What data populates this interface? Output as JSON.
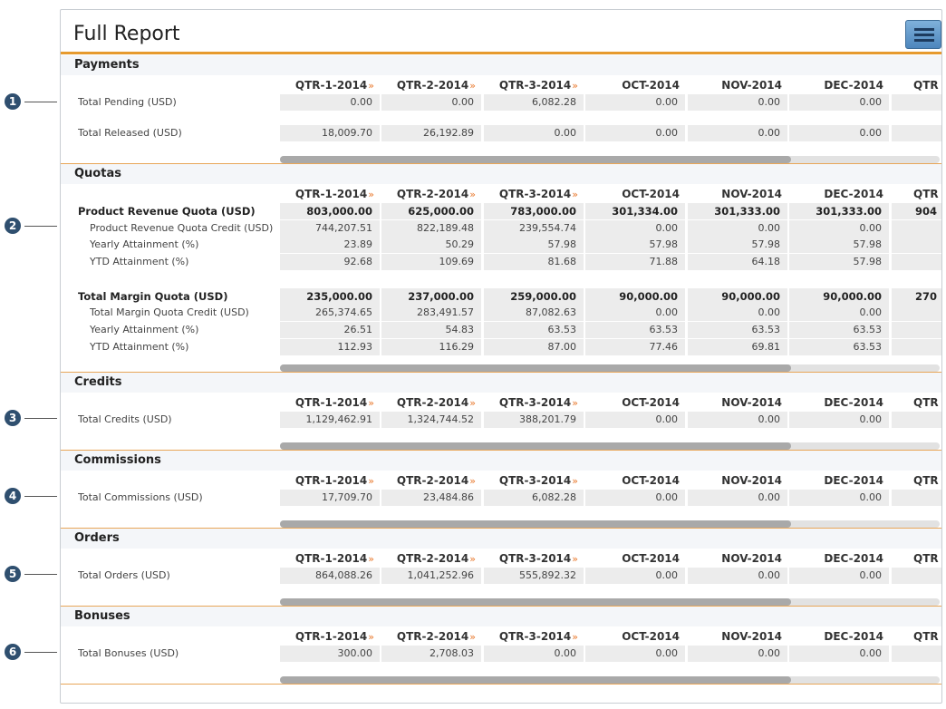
{
  "report": {
    "title": "Full Report"
  },
  "menu_icon": "hamburger-menu-icon",
  "columns": [
    "QTR-1-2014",
    "QTR-2-2014",
    "QTR-3-2014",
    "OCT-2014",
    "NOV-2014",
    "DEC-2014",
    "QTR"
  ],
  "column_expandable": [
    true,
    true,
    true,
    false,
    false,
    false,
    false
  ],
  "callouts": [
    "1",
    "2",
    "3",
    "4",
    "5",
    "6"
  ],
  "colors": {
    "accent": "#e69a2e",
    "callout": "#2f4f6f",
    "arrow": "#e8772a"
  },
  "sections": {
    "payments": {
      "title": "Payments",
      "rows": [
        {
          "label": "Total Pending (USD)",
          "values": [
            "0.00",
            "0.00",
            "6,082.28",
            "0.00",
            "0.00",
            "0.00",
            ""
          ]
        },
        {
          "label": "Total Released (USD)",
          "values": [
            "18,009.70",
            "26,192.89",
            "0.00",
            "0.00",
            "0.00",
            "0.00",
            ""
          ]
        }
      ]
    },
    "quotas": {
      "title": "Quotas",
      "rows": [
        {
          "label": "Product Revenue Quota (USD)",
          "values": [
            "803,000.00",
            "625,000.00",
            "783,000.00",
            "301,334.00",
            "301,333.00",
            "301,333.00",
            "904"
          ]
        },
        {
          "label": "Product Revenue Quota Credit (USD)",
          "values": [
            "744,207.51",
            "822,189.48",
            "239,554.74",
            "0.00",
            "0.00",
            "0.00",
            ""
          ]
        },
        {
          "label": "Yearly Attainment (%)",
          "values": [
            "23.89",
            "50.29",
            "57.98",
            "57.98",
            "57.98",
            "57.98",
            ""
          ]
        },
        {
          "label": "YTD Attainment (%)",
          "values": [
            "92.68",
            "109.69",
            "81.68",
            "71.88",
            "64.18",
            "57.98",
            ""
          ]
        },
        {
          "label": "Total Margin Quota (USD)",
          "values": [
            "235,000.00",
            "237,000.00",
            "259,000.00",
            "90,000.00",
            "90,000.00",
            "90,000.00",
            "270"
          ]
        },
        {
          "label": "Total Margin Quota Credit (USD)",
          "values": [
            "265,374.65",
            "283,491.57",
            "87,082.63",
            "0.00",
            "0.00",
            "0.00",
            ""
          ]
        },
        {
          "label": "Yearly Attainment (%)",
          "values": [
            "26.51",
            "54.83",
            "63.53",
            "63.53",
            "63.53",
            "63.53",
            ""
          ]
        },
        {
          "label": "YTD Attainment (%)",
          "values": [
            "112.93",
            "116.29",
            "87.00",
            "77.46",
            "69.81",
            "63.53",
            ""
          ]
        }
      ]
    },
    "credits": {
      "title": "Credits",
      "rows": [
        {
          "label": "Total Credits (USD)",
          "values": [
            "1,129,462.91",
            "1,324,744.52",
            "388,201.79",
            "0.00",
            "0.00",
            "0.00",
            ""
          ]
        }
      ]
    },
    "commissions": {
      "title": "Commissions",
      "rows": [
        {
          "label": "Total Commissions (USD)",
          "values": [
            "17,709.70",
            "23,484.86",
            "6,082.28",
            "0.00",
            "0.00",
            "0.00",
            ""
          ]
        }
      ]
    },
    "orders": {
      "title": "Orders",
      "rows": [
        {
          "label": "Total Orders (USD)",
          "values": [
            "864,088.26",
            "1,041,252.96",
            "555,892.32",
            "0.00",
            "0.00",
            "0.00",
            ""
          ]
        }
      ]
    },
    "bonuses": {
      "title": "Bonuses",
      "rows": [
        {
          "label": "Total Bonuses (USD)",
          "values": [
            "300.00",
            "2,708.03",
            "0.00",
            "0.00",
            "0.00",
            "0.00",
            ""
          ]
        }
      ]
    }
  }
}
